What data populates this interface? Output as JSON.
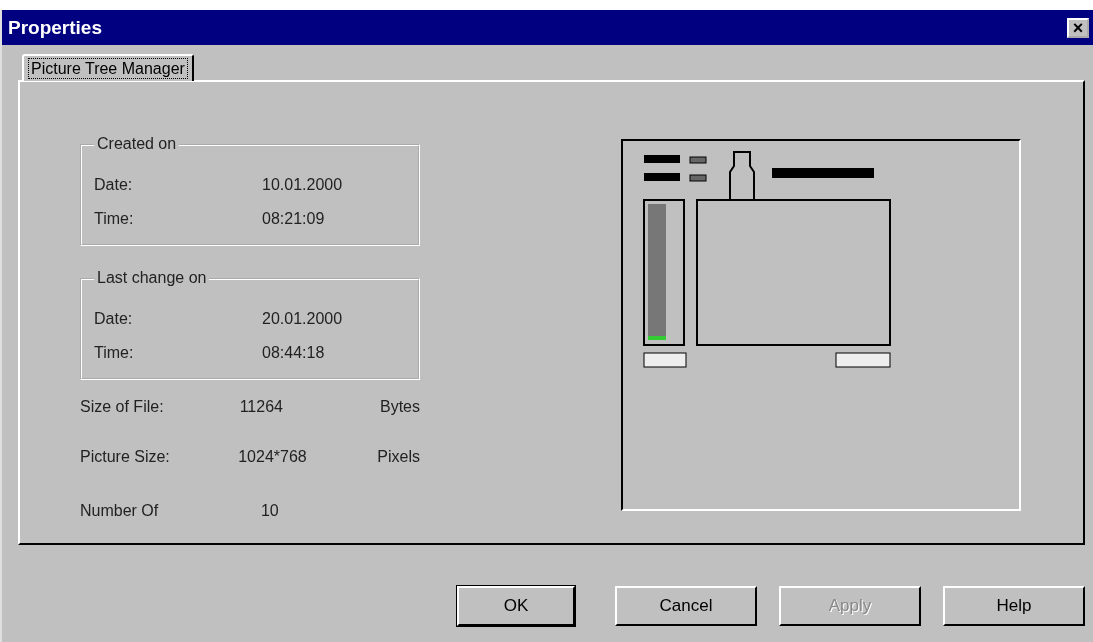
{
  "window": {
    "title": "Properties",
    "close": "×"
  },
  "tabs": [
    {
      "label": "Picture Tree Manager",
      "selected": true
    }
  ],
  "groups": [
    {
      "title": "Created on",
      "rows": [
        {
          "label": "Date:",
          "value": "10.01.2000"
        },
        {
          "label": "Time:",
          "value": "08:21:09"
        }
      ]
    },
    {
      "title": "Last change on",
      "rows": [
        {
          "label": "Date:",
          "value": "20.01.2000"
        },
        {
          "label": "Time:",
          "value": "08:44:18"
        }
      ]
    }
  ],
  "info": [
    {
      "label": "Size of File:",
      "value": "11264",
      "unit": "Bytes"
    },
    {
      "label": "Picture Size:",
      "value": "1024*768",
      "unit": "Pixels"
    },
    {
      "label": "Number Of",
      "value": "10"
    }
  ],
  "buttons": [
    {
      "label": "OK",
      "default": true,
      "disabled": false
    },
    {
      "label": "Cancel",
      "default": false,
      "disabled": false
    },
    {
      "label": "Apply",
      "default": false,
      "disabled": true
    },
    {
      "label": "Help",
      "default": false,
      "disabled": false
    }
  ]
}
